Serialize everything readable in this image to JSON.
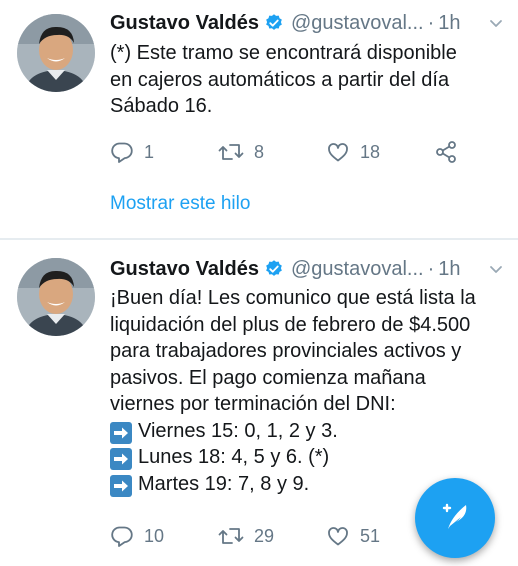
{
  "tweets": [
    {
      "author_name": "Gustavo Valdés",
      "handle": "@gustavoval...",
      "separator": "·",
      "time": "1h",
      "text_lines": [
        "(*) Este tramo se encontrará disponible",
        "en cajeros automáticos a partir del día",
        "Sábado 16."
      ],
      "replies": "1",
      "retweets": "8",
      "likes": "18",
      "show_thread": "Mostrar este hilo"
    },
    {
      "author_name": "Gustavo Valdés",
      "handle": "@gustavoval...",
      "separator": "·",
      "time": "1h",
      "text_lines": [
        "¡Buen día! Les comunico que está lista la",
        "liquidación del plus de febrero de $4.500",
        "para trabajadores provinciales activos y",
        "pasivos. El pago comienza mañana",
        "viernes por terminación del DNI:"
      ],
      "list_items": [
        "Viernes 15: 0, 1, 2 y 3.",
        "Lunes 18: 4, 5 y 6. (*)",
        "Martes 19: 7, 8 y 9."
      ],
      "replies": "10",
      "retweets": "29",
      "likes": "51"
    }
  ],
  "icons": {
    "reply": "reply-icon",
    "retweet": "retweet-icon",
    "like": "heart-icon",
    "share": "share-icon",
    "verified": "verified-badge-icon",
    "caret": "chevron-down-icon",
    "compose": "compose-tweet-icon",
    "list_bullet": "right-arrow-emoji-icon"
  },
  "colors": {
    "accent": "#1da1f2",
    "text": "#14171a",
    "secondary_text": "#657786",
    "divider": "#e6ecf0",
    "emoji_arrow": "#3b88c3"
  }
}
